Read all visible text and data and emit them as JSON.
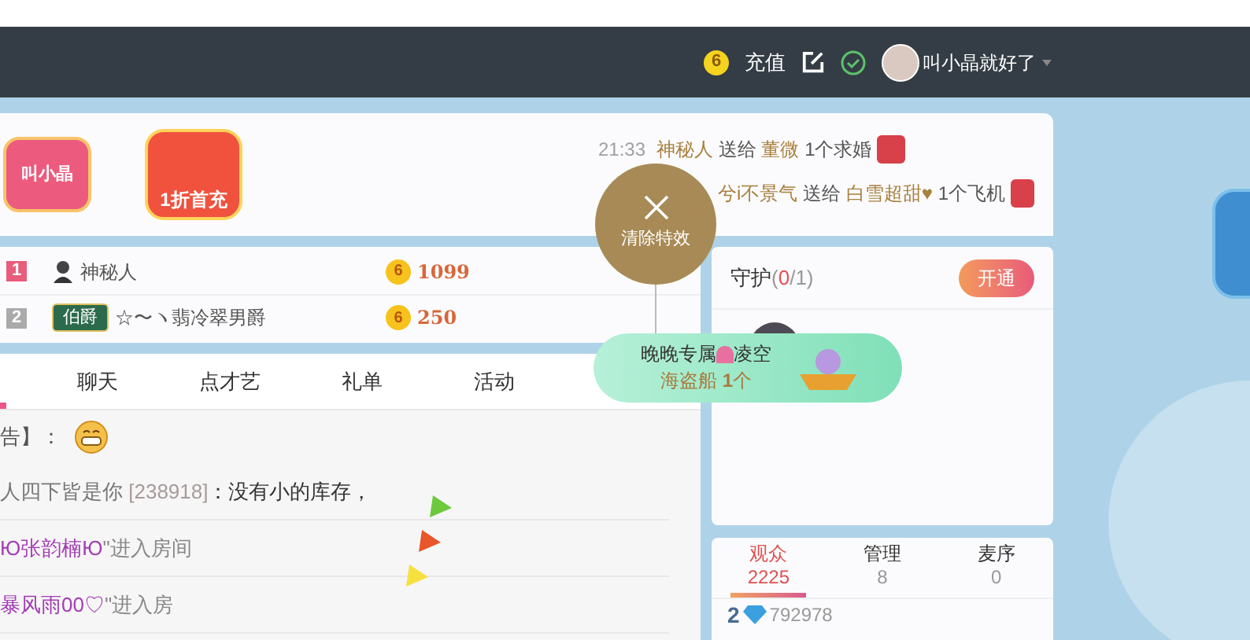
{
  "header": {
    "coin": "6",
    "recharge": "充值",
    "username": "叫小晶就好了"
  },
  "promo": {
    "badge": "叫小晶",
    "red_packet": "1折首充"
  },
  "gift_feed": [
    {
      "time": "21:33",
      "sender": "神秘人",
      "verb": "送给",
      "receiver": "董微",
      "gift": "1个求婚"
    },
    {
      "sender": "兮i不景气",
      "verb": "送给",
      "receiver": "白雪超甜♥",
      "gift": "1个飞机"
    }
  ],
  "ranking": [
    {
      "rank": "1",
      "name": "神秘人",
      "coin": "6",
      "amount": "1099"
    },
    {
      "rank": "2",
      "name": "☆〜ヽ翡冷翠男爵",
      "title": "伯爵",
      "coin": "6",
      "amount": "250"
    }
  ],
  "chat_tabs": [
    {
      "label": "聊天",
      "selected": false
    },
    {
      "label": "点才艺",
      "selected": false
    },
    {
      "label": "礼单",
      "selected": false
    },
    {
      "label": "活动",
      "selected": false
    }
  ],
  "chat": [
    {
      "kind": "notice",
      "text": "告】："
    },
    {
      "kind": "message",
      "user": "人四下皆是你",
      "id": "[238918]",
      "text": "：没有小的库存，"
    },
    {
      "kind": "enter",
      "user": "Ю张韵楠Ю",
      "text": "\"进入房间"
    },
    {
      "kind": "enter",
      "user": "暴风雨00♡",
      "text": "\"进入房"
    }
  ],
  "clear_effects": {
    "label": "清除特效"
  },
  "banner": {
    "line1": "晚晚专属",
    "line1_end": "凌空",
    "line2": "海盗船 **1**个"
  },
  "guardian": {
    "title": "守护",
    "open": "(",
    "count": "0",
    "total": "/1",
    "close": ")",
    "button": "开通"
  },
  "audience_tabs": [
    {
      "label": "观众",
      "count": "2225",
      "selected": true
    },
    {
      "label": "管理",
      "count": "8",
      "selected": false
    },
    {
      "label": "麦序",
      "count": "0",
      "selected": false
    }
  ],
  "audience": [
    {
      "level": "2",
      "score": "792978"
    }
  ]
}
